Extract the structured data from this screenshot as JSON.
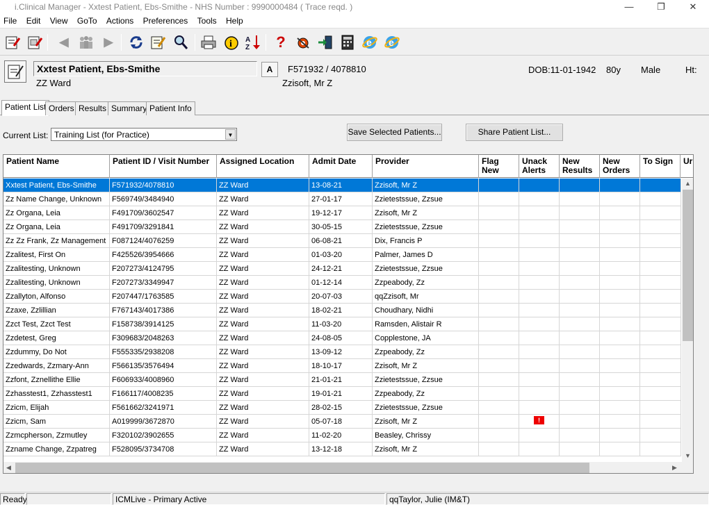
{
  "window": {
    "title": "i.Clinical Manager - Xxtest Patient, Ebs-Smithe - NHS Number : 9990000484 ( Trace reqd. )",
    "minimize": "—",
    "restore": "❐",
    "close": "✕"
  },
  "menu": [
    "File",
    "Edit",
    "View",
    "GoTo",
    "Actions",
    "Preferences",
    "Tools",
    "Help"
  ],
  "toolbar_icons": [
    "patient-list-icon",
    "patient-list-2-icon",
    "back-arrow-icon",
    "people-icon",
    "forward-arrow-icon",
    "refresh-icon",
    "notes-icon",
    "search-icon",
    "print-icon",
    "info-icon",
    "sort-az-icon",
    "help-icon",
    "settings-icon",
    "exit-icon",
    "calculator-icon",
    "ie-icon",
    "ie-icon-2"
  ],
  "patient": {
    "name": "Xxtest Patient, Ebs-Smithe",
    "ward": "ZZ Ward",
    "alert_button": "A",
    "ids": "F571932 / 4078810",
    "provider": "Zzisoft, Mr Z",
    "dob": "DOB:11-01-1942",
    "age": "80y",
    "sex": "Male",
    "ht": "Ht:"
  },
  "tabs": [
    "Patient List",
    "Orders",
    "Results",
    "Summary",
    "Patient Info"
  ],
  "current_list": {
    "label": "Current List:",
    "value": "Training List (for Practice)"
  },
  "buttons": {
    "save_selected": "Save Selected Patients...",
    "share_list": "Share Patient List..."
  },
  "columns": [
    "Patient Name",
    "Patient ID / Visit Number",
    "Assigned Location",
    "Admit Date",
    "Provider",
    "Flag New",
    "Unack Alerts",
    "New Results",
    "New Orders",
    "To Sign",
    "Ur"
  ],
  "rows": [
    {
      "name": "Xxtest Patient, Ebs-Smithe",
      "id": "F571932/4078810",
      "loc": "ZZ Ward",
      "admit": "13-08-21",
      "provider": "Zzisoft, Mr Z",
      "alert": ""
    },
    {
      "name": "Zz Name Change, Unknown",
      "id": "F569749/3484940",
      "loc": "ZZ Ward",
      "admit": "27-01-17",
      "provider": "Zzietestssue, Zzsue",
      "alert": ""
    },
    {
      "name": "Zz Organa, Leia",
      "id": "F491709/3602547",
      "loc": "ZZ Ward",
      "admit": "19-12-17",
      "provider": "Zzisoft, Mr Z",
      "alert": ""
    },
    {
      "name": "Zz Organa, Leia",
      "id": "F491709/3291841",
      "loc": "ZZ Ward",
      "admit": "30-05-15",
      "provider": "Zzietestssue, Zzsue",
      "alert": ""
    },
    {
      "name": "Zz Zz Frank, Zz Management",
      "id": "F087124/4076259",
      "loc": "ZZ Ward",
      "admit": "06-08-21",
      "provider": "Dix, Francis P",
      "alert": ""
    },
    {
      "name": "Zzalitest, First On",
      "id": "F425526/3954666",
      "loc": "ZZ Ward",
      "admit": "01-03-20",
      "provider": "Palmer, James D",
      "alert": ""
    },
    {
      "name": "Zzalitesting, Unknown",
      "id": "F207273/4124795",
      "loc": "ZZ Ward",
      "admit": "24-12-21",
      "provider": "Zzietestssue, Zzsue",
      "alert": ""
    },
    {
      "name": "Zzalitesting, Unknown",
      "id": "F207273/3349947",
      "loc": "ZZ Ward",
      "admit": "01-12-14",
      "provider": "Zzpeabody, Zz",
      "alert": ""
    },
    {
      "name": "Zzallyton, Alfonso",
      "id": "F207447/1763585",
      "loc": "ZZ Ward",
      "admit": "20-07-03",
      "provider": "qqZzisoft, Mr",
      "alert": ""
    },
    {
      "name": "Zzaxe, Zzlillian",
      "id": "F767143/4017386",
      "loc": "ZZ Ward",
      "admit": "18-02-21",
      "provider": "Choudhary, Nidhi",
      "alert": ""
    },
    {
      "name": "Zzct Test, Zzct Test",
      "id": "F158738/3914125",
      "loc": "ZZ Ward",
      "admit": "11-03-20",
      "provider": "Ramsden, Alistair R",
      "alert": ""
    },
    {
      "name": "Zzdetest, Greg",
      "id": "F309683/2048263",
      "loc": "ZZ Ward",
      "admit": "24-08-05",
      "provider": "Copplestone, JA",
      "alert": ""
    },
    {
      "name": "Zzdummy, Do Not",
      "id": "F555335/2938208",
      "loc": "ZZ Ward",
      "admit": "13-09-12",
      "provider": "Zzpeabody, Zz",
      "alert": ""
    },
    {
      "name": "Zzedwards, Zzmary-Ann",
      "id": "F566135/3576494",
      "loc": "ZZ Ward",
      "admit": "18-10-17",
      "provider": "Zzisoft, Mr Z",
      "alert": ""
    },
    {
      "name": "Zzfont, Zznellithe Ellie",
      "id": "F606933/4008960",
      "loc": "ZZ Ward",
      "admit": "21-01-21",
      "provider": "Zzietestssue, Zzsue",
      "alert": ""
    },
    {
      "name": "Zzhasstest1, Zzhasstest1",
      "id": "F166117/4008235",
      "loc": "ZZ Ward",
      "admit": "19-01-21",
      "provider": "Zzpeabody, Zz",
      "alert": ""
    },
    {
      "name": "Zzicm, Elijah",
      "id": "F561662/3241971",
      "loc": "ZZ Ward",
      "admit": "28-02-15",
      "provider": "Zzietestssue, Zzsue",
      "alert": ""
    },
    {
      "name": "Zzicm, Sam",
      "id": "A019999/3672870",
      "loc": "ZZ Ward",
      "admit": "05-07-18",
      "provider": "Zzisoft, Mr Z",
      "alert": "!"
    },
    {
      "name": "Zzmcpherson, Zzmutley",
      "id": "F320102/3902655",
      "loc": "ZZ Ward",
      "admit": "11-02-20",
      "provider": "Beasley, Chrissy",
      "alert": ""
    },
    {
      "name": "Zzname Change, Zzpatreg",
      "id": "F528095/3734708",
      "loc": "ZZ Ward",
      "admit": "13-12-18",
      "provider": "Zzisoft, Mr Z",
      "alert": ""
    }
  ],
  "status": {
    "ready": "Ready",
    "server": "ICMLive - Primary Active",
    "user": "qqTaylor, Julie (IM&T)"
  },
  "colors": {
    "selection": "#0078d7",
    "alert_flag": "#e00000"
  }
}
